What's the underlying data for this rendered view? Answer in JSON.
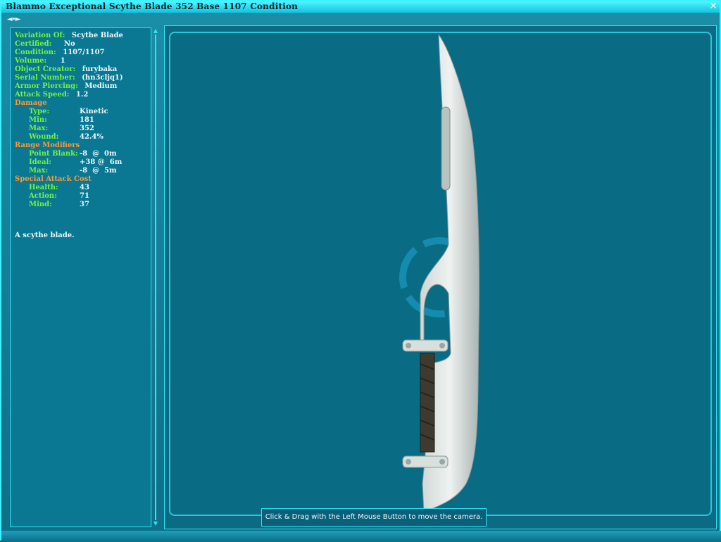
{
  "window": {
    "title": "Blammo Exceptional Scythe Blade 352 Base 1107 Condition",
    "close_icon": "close-icon",
    "nav_label": "◄•►"
  },
  "attributes": {
    "variation_of": {
      "label": "Variation Of:",
      "value": "Scythe Blade"
    },
    "certified": {
      "label": "Certified:",
      "value": "No"
    },
    "condition": {
      "label": "Condition:",
      "value": "1107/1107"
    },
    "volume": {
      "label": "Volume:",
      "value": "1"
    },
    "object_creator": {
      "label": "Object Creator:",
      "value": "furybaka"
    },
    "serial_number": {
      "label": "Serial Number:",
      "value": "(hn3cljq1)"
    },
    "armor_piercing": {
      "label": "Armor Piercing:",
      "value": "Medium"
    },
    "attack_speed": {
      "label": "Attack Speed:",
      "value": "1.2"
    },
    "damage": {
      "heading": "Damage",
      "type": {
        "label": "Type:",
        "value": "Kinetic"
      },
      "min": {
        "label": "Min:",
        "value": "181"
      },
      "max": {
        "label": "Max:",
        "value": "352"
      },
      "wound": {
        "label": "Wound:",
        "value": "42.4%"
      }
    },
    "range_modifiers": {
      "heading": "Range Modifiers",
      "point_blank": {
        "label": "Point Blank:",
        "value": "-8  @  0m"
      },
      "ideal": {
        "label": "Ideal:",
        "value": "+38 @  6m"
      },
      "max": {
        "label": "Max:",
        "value": "-8  @  5m"
      }
    },
    "special_attack_cost": {
      "heading": "Special Attack Cost",
      "health": {
        "label": "Health:",
        "value": "43"
      },
      "action": {
        "label": "Action:",
        "value": "71"
      },
      "mind": {
        "label": "Mind:",
        "value": "37"
      }
    }
  },
  "description": "A scythe blade.",
  "viewer": {
    "tooltip": "Click & Drag with the Left Mouse Button to move the camera."
  },
  "colors": {
    "label_green": "#73f53d",
    "section_orange": "#ff9933",
    "value_white": "#eefaff",
    "frame_cyan": "#2fe3f4"
  }
}
